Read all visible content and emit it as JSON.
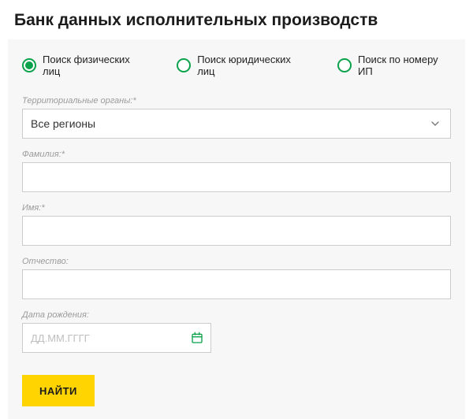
{
  "title": "Банк данных исполнительных производств",
  "tabs": {
    "individual": "Поиск физических лиц",
    "legal": "Поиск юридических лиц",
    "case": "Поиск по номеру ИП",
    "selected": "individual"
  },
  "fields": {
    "region": {
      "label": "Территориальные органы:*",
      "value": "Все регионы"
    },
    "lastname": {
      "label": "Фамилия:*",
      "value": ""
    },
    "firstname": {
      "label": "Имя:*",
      "value": ""
    },
    "patronymic": {
      "label": "Отчество:",
      "value": ""
    },
    "dob": {
      "label": "Дата рождения:",
      "value": "",
      "placeholder": "ДД.ММ.ГГГГ"
    }
  },
  "submit": "НАЙТИ",
  "colors": {
    "accent_green": "#0aa24a",
    "accent_yellow": "#ffd400",
    "panel_bg": "#f7f7f7"
  }
}
